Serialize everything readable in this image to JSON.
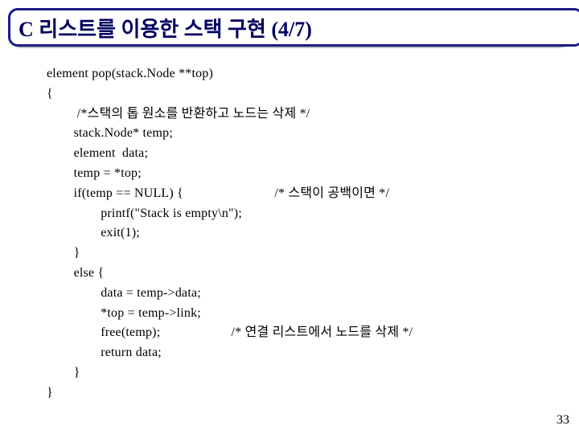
{
  "title": "C 리스트를 이용한 스택 구현 (4/7)",
  "page_number": "33",
  "code": {
    "l1": "element pop(stack.Node **top)",
    "l2": "{",
    "l3": "         /*스택의 톱 원소를 반환하고 노드는 삭제 */",
    "l4": "        stack.Node* temp;",
    "l5": "        element  data;",
    "l6": "        temp = *top;",
    "l7": "        if(temp == NULL) {                           /* 스택이 공백이면 */",
    "l8": "                printf(\"Stack is empty\\n\");",
    "l9": "                exit(1);",
    "l10": "        }",
    "l11": "        else {",
    "l12": "                data = temp->data;",
    "l13": "                *top = temp->link;",
    "l14": "                free(temp);                     /* 연결 리스트에서 노드를 삭제 */",
    "l15": "                return data;",
    "l16": "        }",
    "l17": "}"
  }
}
